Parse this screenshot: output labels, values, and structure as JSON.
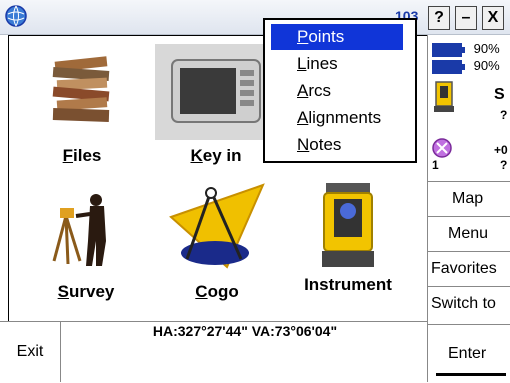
{
  "titlebar": {
    "number": "103",
    "help_label": "?",
    "minimize_label": "–",
    "close_label": "X"
  },
  "main": {
    "items": [
      {
        "label_u": "F",
        "label_rest": "iles"
      },
      {
        "label_u": "K",
        "label_rest": "ey in"
      },
      {
        "label_u": "S",
        "label_rest": "urvey"
      },
      {
        "label_u": "C",
        "label_rest": "ogo"
      },
      {
        "label_u": "",
        "label_rest": "Instrument"
      }
    ]
  },
  "popup_menu": {
    "items": [
      {
        "u": "P",
        "rest": "oints",
        "active": true
      },
      {
        "u": "L",
        "rest": "ines",
        "active": false
      },
      {
        "u": "A",
        "rest": "rcs",
        "active": false
      },
      {
        "u": "A",
        "rest": "lignments",
        "active": false
      },
      {
        "u": "N",
        "rest": "otes",
        "active": false
      }
    ]
  },
  "status": {
    "battery1": "90%",
    "battery2": "90%",
    "instrument_letter": "S",
    "instrument_q": "?",
    "gps_value": "+0",
    "gps_q": "?",
    "gps_count": "1",
    "angle_readout": "HA:327°27'44\"  VA:73°06'04\""
  },
  "right_buttons": {
    "map": "Map",
    "menu": "Menu",
    "favorites": "Favorites",
    "switch_to": "Switch to",
    "enter": "Enter"
  },
  "bottom": {
    "exit": "Exit"
  },
  "colors": {
    "menu_highlight": "#1035d8",
    "battery": "#1a3aa8"
  }
}
